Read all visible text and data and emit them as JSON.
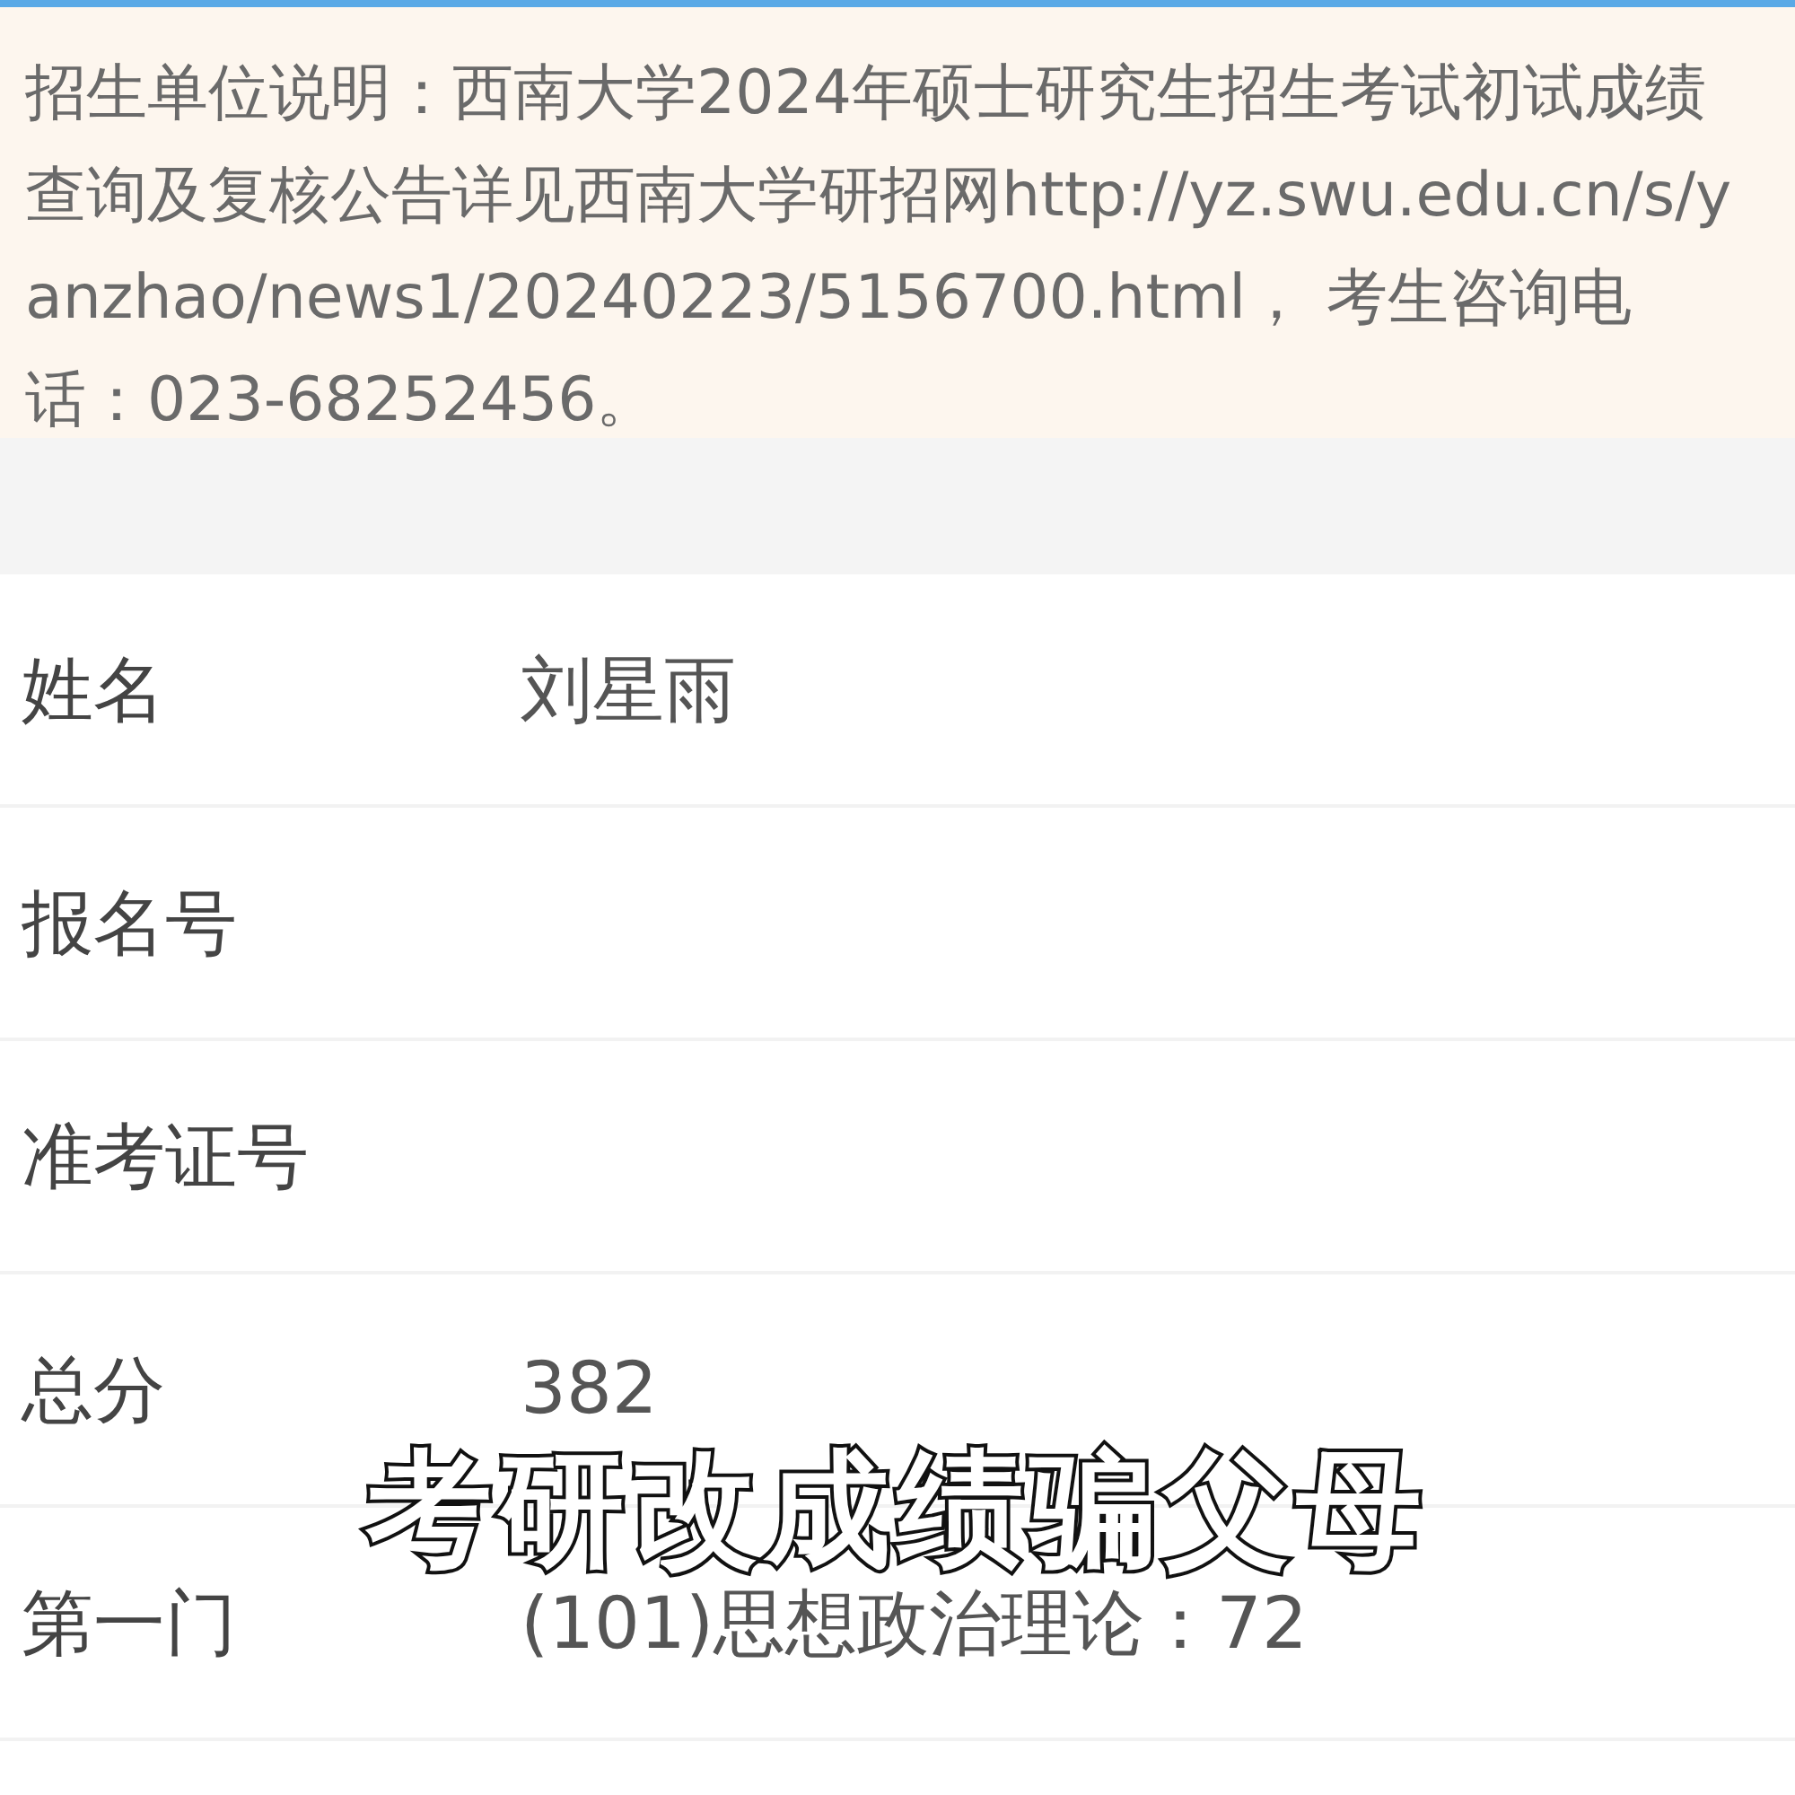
{
  "notice": "招生单位说明：西南大学2024年硕士研究生招生考试初试成绩查询及复核公告详见西南大学研招网http://yz.swu.edu.cn/s/yanzhao/news1/20240223/5156700.html， 考生咨询电话：023-68252456。",
  "fields": [
    {
      "label": "姓名",
      "value": "刘星雨"
    },
    {
      "label": "报名号"
    },
    {
      "label": "准考证号"
    },
    {
      "label": "总分",
      "value": "382"
    },
    {
      "label": "第一门",
      "value": "(101)思想政治理论：72"
    }
  ],
  "caption": "考研改成绩骗父母"
}
